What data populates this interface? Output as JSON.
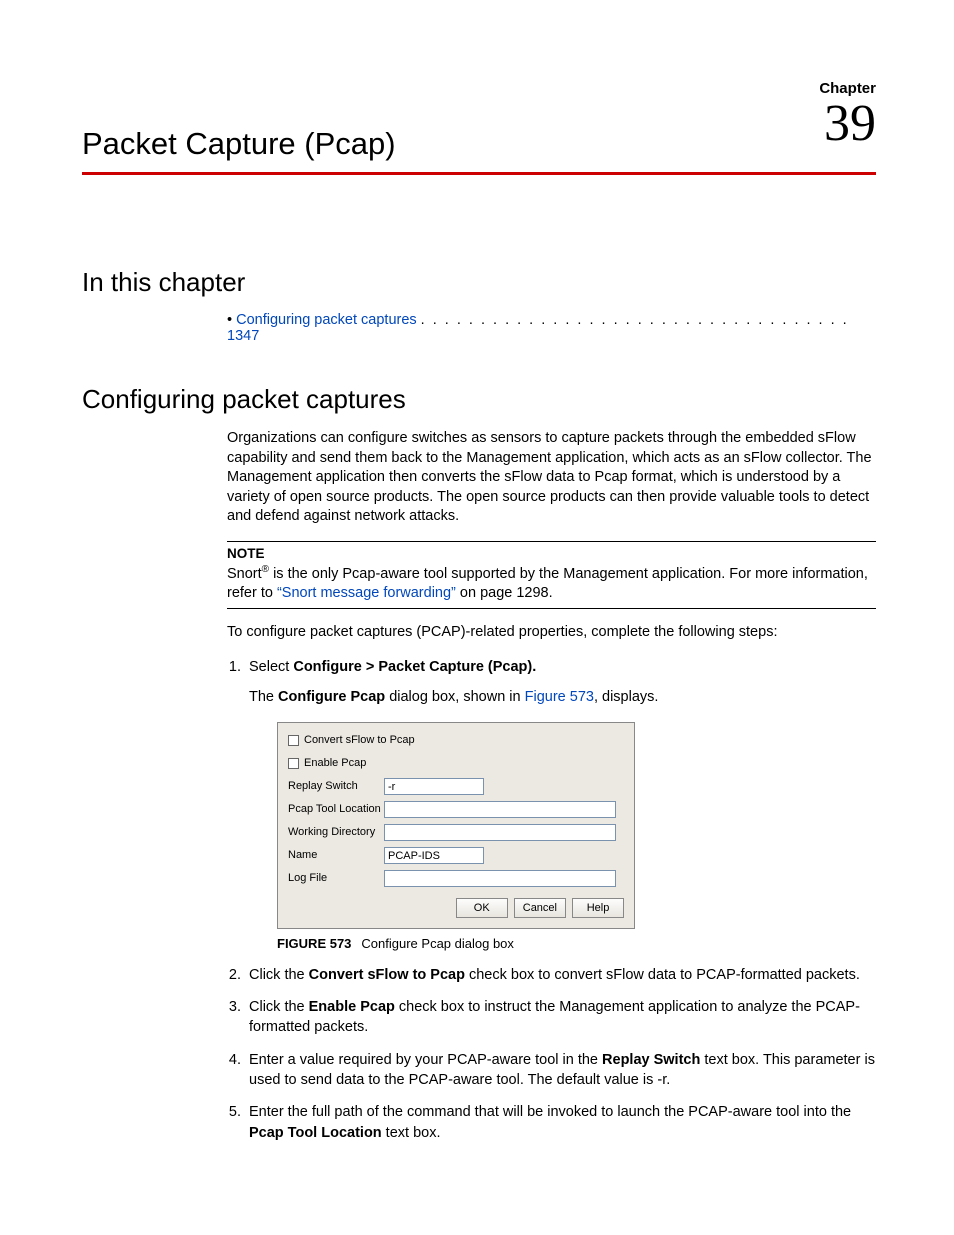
{
  "header": {
    "chapter_label": "Chapter",
    "chapter_number": "39",
    "title": "Packet Capture (Pcap)"
  },
  "sections": {
    "in_this_chapter": "In this chapter",
    "configuring": "Configuring packet captures"
  },
  "toc": {
    "bullet": "•",
    "item": "Configuring packet captures",
    "dots": ". . . . . . . . . . . . . . . . . . . . . . . . . . . . . . . . . . . .",
    "page": "1347"
  },
  "intro_paragraph": "Organizations can configure switches as sensors to capture packets through the embedded sFlow capability and send them back to the Management application, which acts as an sFlow collector. The Management application then converts the sFlow data to Pcap format, which is understood by a variety of open source products. The open source products can then provide valuable tools to detect and defend against network attacks.",
  "note": {
    "label": "NOTE",
    "pre": "Snort",
    "sup": "®",
    "mid": " is the only Pcap-aware tool supported by the Management application. For more information, refer to ",
    "link": "“Snort message forwarding”",
    "post": " on page 1298."
  },
  "lead_in": "To configure packet captures (PCAP)-related properties, complete the following steps:",
  "steps": {
    "s1_pre": "Select ",
    "s1_bold": "Configure > Packet Capture (Pcap).",
    "s1_sub_pre": "The ",
    "s1_sub_bold": "Configure Pcap",
    "s1_sub_mid": " dialog box, shown in ",
    "s1_sub_link": "Figure 573",
    "s1_sub_post": ", displays.",
    "s2_pre": "Click the ",
    "s2_bold": "Convert sFlow to Pcap",
    "s2_post": " check box to convert sFlow data to PCAP-formatted packets.",
    "s3_pre": "Click the ",
    "s3_bold": "Enable Pcap",
    "s3_post": " check box to instruct the Management application to analyze the PCAP-formatted packets.",
    "s4_pre": "Enter a value required by your PCAP-aware tool in the ",
    "s4_bold": "Replay Switch",
    "s4_post": " text box. This parameter is used to send data to the PCAP-aware tool. The default value is -r.",
    "s5_pre": "Enter the full path of the command that will be invoked to launch the PCAP-aware tool into the ",
    "s5_bold": "Pcap Tool Location",
    "s5_post": " text box."
  },
  "dialog": {
    "checkbox1": "Convert sFlow to Pcap",
    "checkbox2": "Enable Pcap",
    "replay_switch_label": "Replay Switch",
    "replay_switch_value": "-r",
    "tool_location_label": "Pcap Tool Location",
    "tool_location_value": "",
    "working_dir_label": "Working Directory",
    "working_dir_value": "",
    "name_label": "Name",
    "name_value": "PCAP-IDS",
    "logfile_label": "Log File",
    "logfile_value": "",
    "ok": "OK",
    "cancel": "Cancel",
    "help": "Help"
  },
  "figure": {
    "label": "FIGURE 573",
    "caption": "Configure Pcap dialog box"
  }
}
